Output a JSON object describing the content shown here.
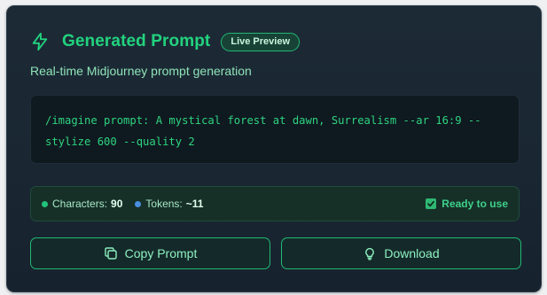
{
  "header": {
    "title": "Generated Prompt",
    "badge": "Live Preview",
    "icon": "lightning-bolt-icon"
  },
  "subtitle": "Real-time Midjourney prompt generation",
  "prompt": {
    "text": "/imagine prompt: A mystical forest at dawn, Surrealism --ar 16:9 --stylize 600 --quality 2"
  },
  "stats": {
    "characters_label": "Characters:",
    "characters_value": "90",
    "tokens_label": "Tokens:",
    "tokens_value": "~11",
    "ready_label": "Ready to use"
  },
  "actions": {
    "copy_label": "Copy Prompt",
    "copy_icon": "copy-icon",
    "download_label": "Download",
    "download_icon": "lightbulb-icon"
  },
  "colors": {
    "accent": "#22d37e",
    "card_background": "#1c2a36",
    "prompt_background": "#0f1920",
    "tokens_dot": "#4a8ee0"
  }
}
